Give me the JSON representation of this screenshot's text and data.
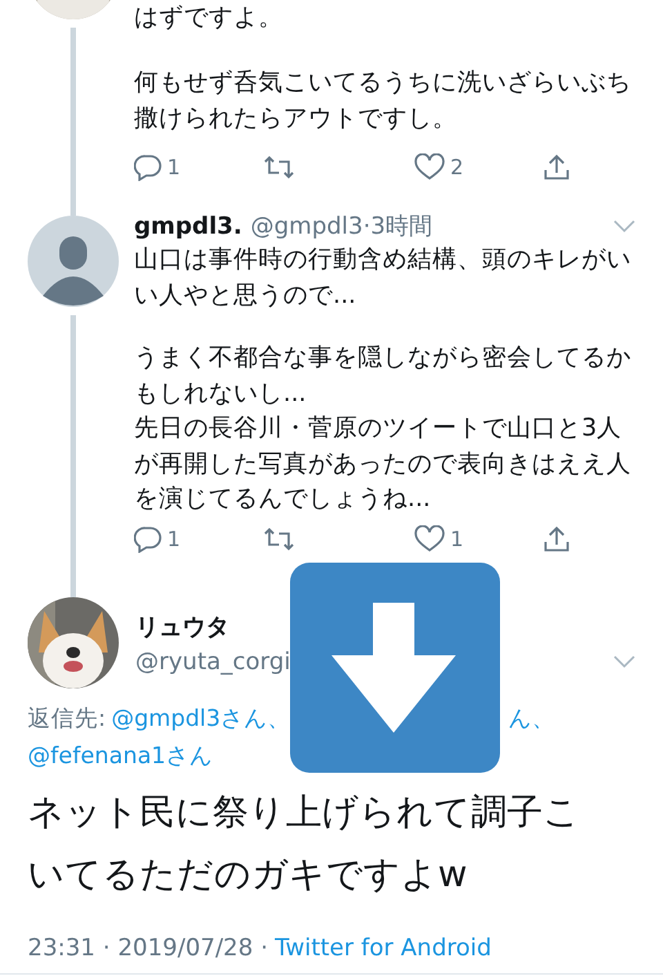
{
  "thread": [
    {
      "avatar": {
        "kind": "picture"
      },
      "paragraphs": [
        [
          "はずですよ。"
        ],
        [
          "何もせず呑気こいてるうちに洗いざらいぶち",
          "撒けられたらアウトですし。"
        ]
      ],
      "actions": {
        "replies": "1",
        "likes": "2"
      }
    },
    {
      "avatar": {
        "kind": "default"
      },
      "name": "gmpdl3.",
      "meta": "@gmpdl3·3時間",
      "paragraphs": [
        [
          "山口は事件時の行動含め結構、頭のキレがい",
          "い人やと思うので..."
        ],
        [
          "うまく不都合な事を隠しながら密会してるか",
          "もしれないし...",
          "先日の長谷川・菅原のツイートで山口と3人",
          "が再開した写真があったので表向きはええ人",
          "を演じてるんでしょうね..."
        ]
      ],
      "actions": {
        "replies": "1",
        "likes": "1"
      }
    }
  ],
  "focal": {
    "name": "リュウタ",
    "handle": "@ryuta_corgi",
    "reply_label": "返信先:",
    "reply_lines": [
      [
        "@gmpdl3さん、",
        "ん、"
      ],
      [
        "@fefenana1さん"
      ]
    ],
    "text_lines": [
      "ネット民に祭り上げられて調子こ",
      "いてるただのガキですよw"
    ],
    "time": "23:31 · 2019/07/28 ·",
    "source": "Twitter for Android"
  }
}
